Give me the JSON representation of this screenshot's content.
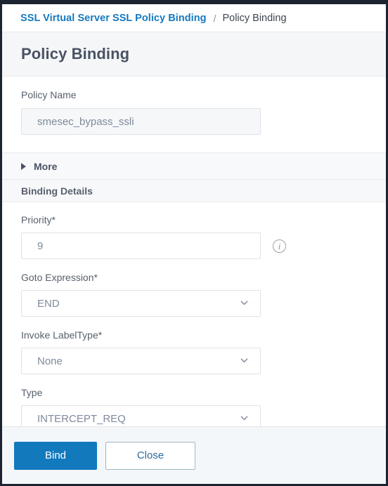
{
  "breadcrumb": {
    "parent_label": "SSL Virtual Server SSL Policy Binding",
    "separator": "/",
    "current_label": "Policy Binding"
  },
  "page": {
    "title": "Policy Binding"
  },
  "policy": {
    "name_label": "Policy Name",
    "name_value": "smesec_bypass_ssli"
  },
  "more_section": {
    "label": "More",
    "expanded": false,
    "icon": "triangle-right-icon"
  },
  "binding_details": {
    "header": "Binding Details",
    "fields": [
      {
        "label": "Priority*",
        "value": "9",
        "control": "text",
        "info_icon": "info-circle-icon"
      },
      {
        "label": "Goto Expression*",
        "value": "END",
        "control": "select",
        "icon": "chevron-down-icon"
      },
      {
        "label": "Invoke LabelType*",
        "value": "None",
        "control": "select",
        "icon": "chevron-down-icon"
      },
      {
        "label": "Type",
        "value": "INTERCEPT_REQ",
        "control": "select",
        "icon": "chevron-down-icon"
      }
    ]
  },
  "footer": {
    "bind_label": "Bind",
    "close_label": "Close"
  },
  "colors": {
    "link": "#1579be",
    "primary_button": "#1279bd",
    "title_text": "#4a5263",
    "field_text": "#7f8a9b",
    "band_background": "#f4f6f8",
    "frame": "#1b2430"
  }
}
